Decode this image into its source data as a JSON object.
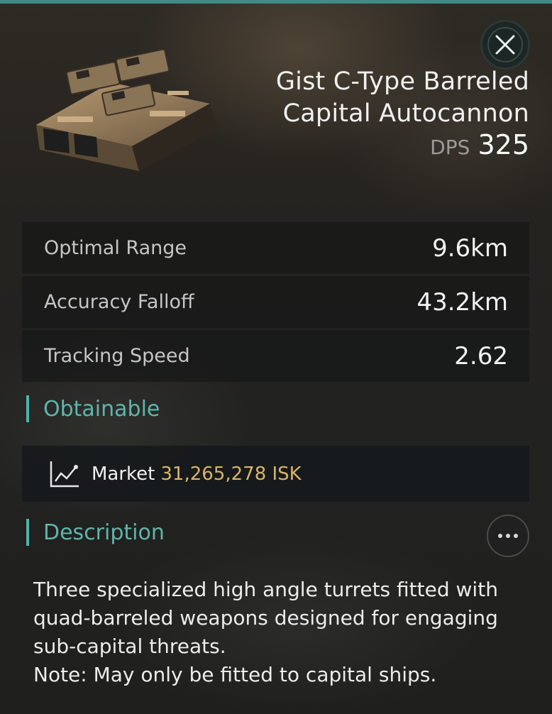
{
  "item": {
    "name": "Gist C-Type Barreled Capital Autocannon",
    "dps_label": "DPS",
    "dps_value": "325"
  },
  "stats": [
    {
      "label": "Optimal Range",
      "value": "9.6km"
    },
    {
      "label": "Accuracy Falloff",
      "value": "43.2km"
    },
    {
      "label": "Tracking Speed",
      "value": "2.62"
    }
  ],
  "sections": {
    "obtainable": "Obtainable",
    "description": "Description"
  },
  "market": {
    "label": "Market",
    "price": "31,265,278 ISK",
    "icon": "line-chart-icon"
  },
  "description": {
    "text": "Three specialized high angle turrets fitted with quad-barreled weapons designed for engaging sub-capital threats.",
    "note": "Note: May only be fitted to capital ships."
  },
  "colors": {
    "accent": "#4fb3aa",
    "price": "#d9b46a",
    "top_bar": "#3f8c86"
  },
  "icons": [
    "close-icon",
    "more-options-icon",
    "line-chart-icon"
  ]
}
